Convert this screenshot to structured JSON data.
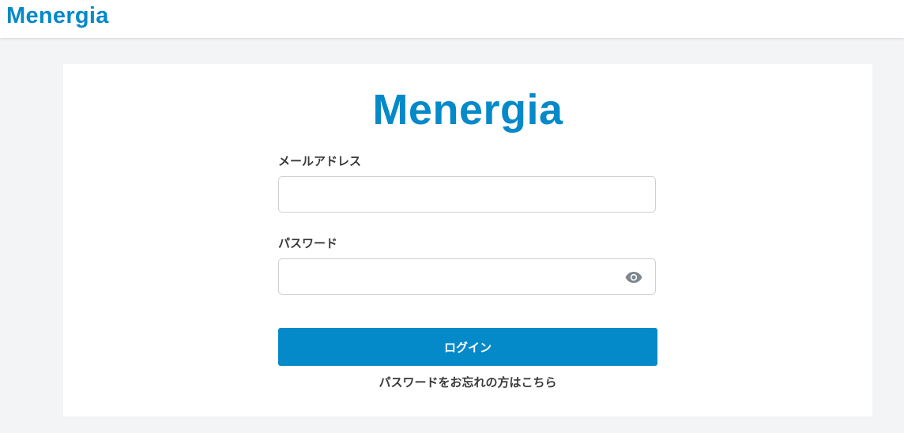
{
  "brand": {
    "name": "Menergia",
    "color": "#0489c9"
  },
  "form": {
    "email_label": "メールアドレス",
    "email_value": "",
    "password_label": "パスワード",
    "password_value": "",
    "password_toggle_icon": "eye-icon",
    "login_label": "ログイン",
    "login_color": "#0489c9",
    "forgot_label": "パスワードをお忘れの方はこちら"
  }
}
